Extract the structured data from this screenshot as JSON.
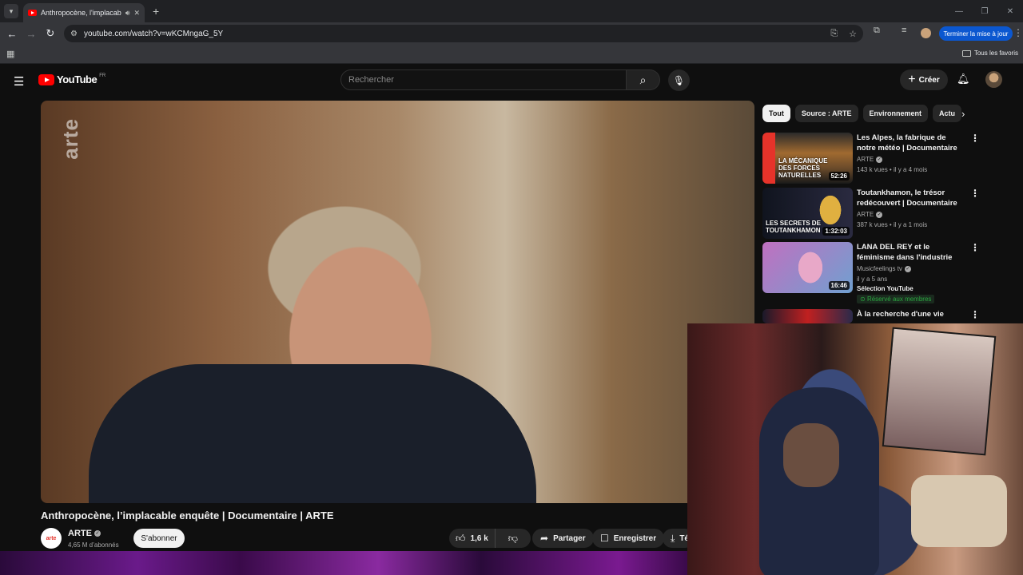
{
  "browser": {
    "tab_title": "Anthropocène, l'implacable",
    "url": "youtube.com/watch?v=wKCMngaG_5Y",
    "update_button": "Terminer la mise à jour",
    "all_bookmarks": "Tous les favoris"
  },
  "masthead": {
    "logo_text": "YouTube",
    "country_code": "FR",
    "search_placeholder": "Rechercher",
    "create_label": "Créer"
  },
  "video": {
    "watermark": "arte",
    "title": "Anthropocène, l’implacable enquête | Documentaire | ARTE",
    "channel_logo_text": "arte",
    "channel_name": "ARTE",
    "subscribers": "4,65 M d’abonnés",
    "subscribe_label": "S'abonner",
    "likes": "1,6 k",
    "share_label": "Partager",
    "save_label": "Enregistrer",
    "download_label": "Té"
  },
  "chips": [
    "Tout",
    "Source : ARTE",
    "Environnement",
    "Actu"
  ],
  "recommendations": [
    {
      "title": "Les Alpes, la fabrique de notre météo | Documentaire | ARTE",
      "channel": "ARTE",
      "views": "143 k vues",
      "age": "il y a 4 mois",
      "duration": "52:26",
      "thumb_caption": "LA MÉCANIQUE DES FORCES NATURELLES"
    },
    {
      "title": "Toutankhamon, le trésor redécouvert | Documentaire ...",
      "channel": "ARTE",
      "views": "387 k vues",
      "age": "il y a 1 mois",
      "duration": "1:32:03",
      "thumb_caption": "LES SECRETS DE TOUTANKHAMON"
    },
    {
      "title": "LANA DEL REY et le féminisme dans l'industrie du disque.",
      "channel": "Musicfeelings tv",
      "age": "il y a 5 ans",
      "duration": "16:46",
      "selection": "Sélection YouTube",
      "members": "Réservé aux membres"
    },
    {
      "title": "À la recherche d'une vie"
    }
  ],
  "colors": {
    "background": "#0f0f0f",
    "youtube_red": "#ff0000",
    "update_blue": "#0b57d0",
    "members_green": "#2ba640"
  }
}
